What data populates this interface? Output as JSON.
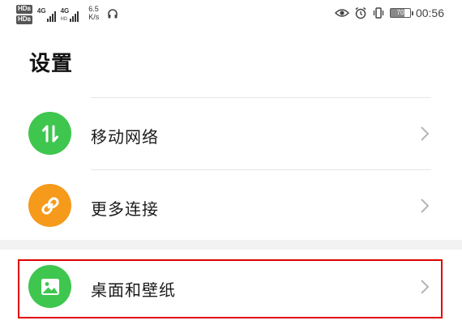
{
  "status_bar": {
    "hd1": "HD",
    "hd1_sub": "B",
    "hd2": "HD",
    "hd2_sub": "B",
    "net1": "4G",
    "net2": "4G",
    "net2_sub": "HD",
    "speed_value": "6.5",
    "speed_unit": "K/s",
    "battery_level": "70",
    "time": "00:56"
  },
  "page": {
    "title": "设置"
  },
  "settings": [
    {
      "label": "移动网络",
      "icon": "mobile-data-icon",
      "color": "#3fc64f"
    },
    {
      "label": "更多连接",
      "icon": "link-icon",
      "color": "#f59a1b"
    },
    {
      "label": "桌面和壁纸",
      "icon": "wallpaper-icon",
      "color": "#3fc64f"
    }
  ],
  "colors": {
    "accent_green": "#3fc64f",
    "accent_orange": "#f59a1b",
    "highlight": "#e00000"
  }
}
